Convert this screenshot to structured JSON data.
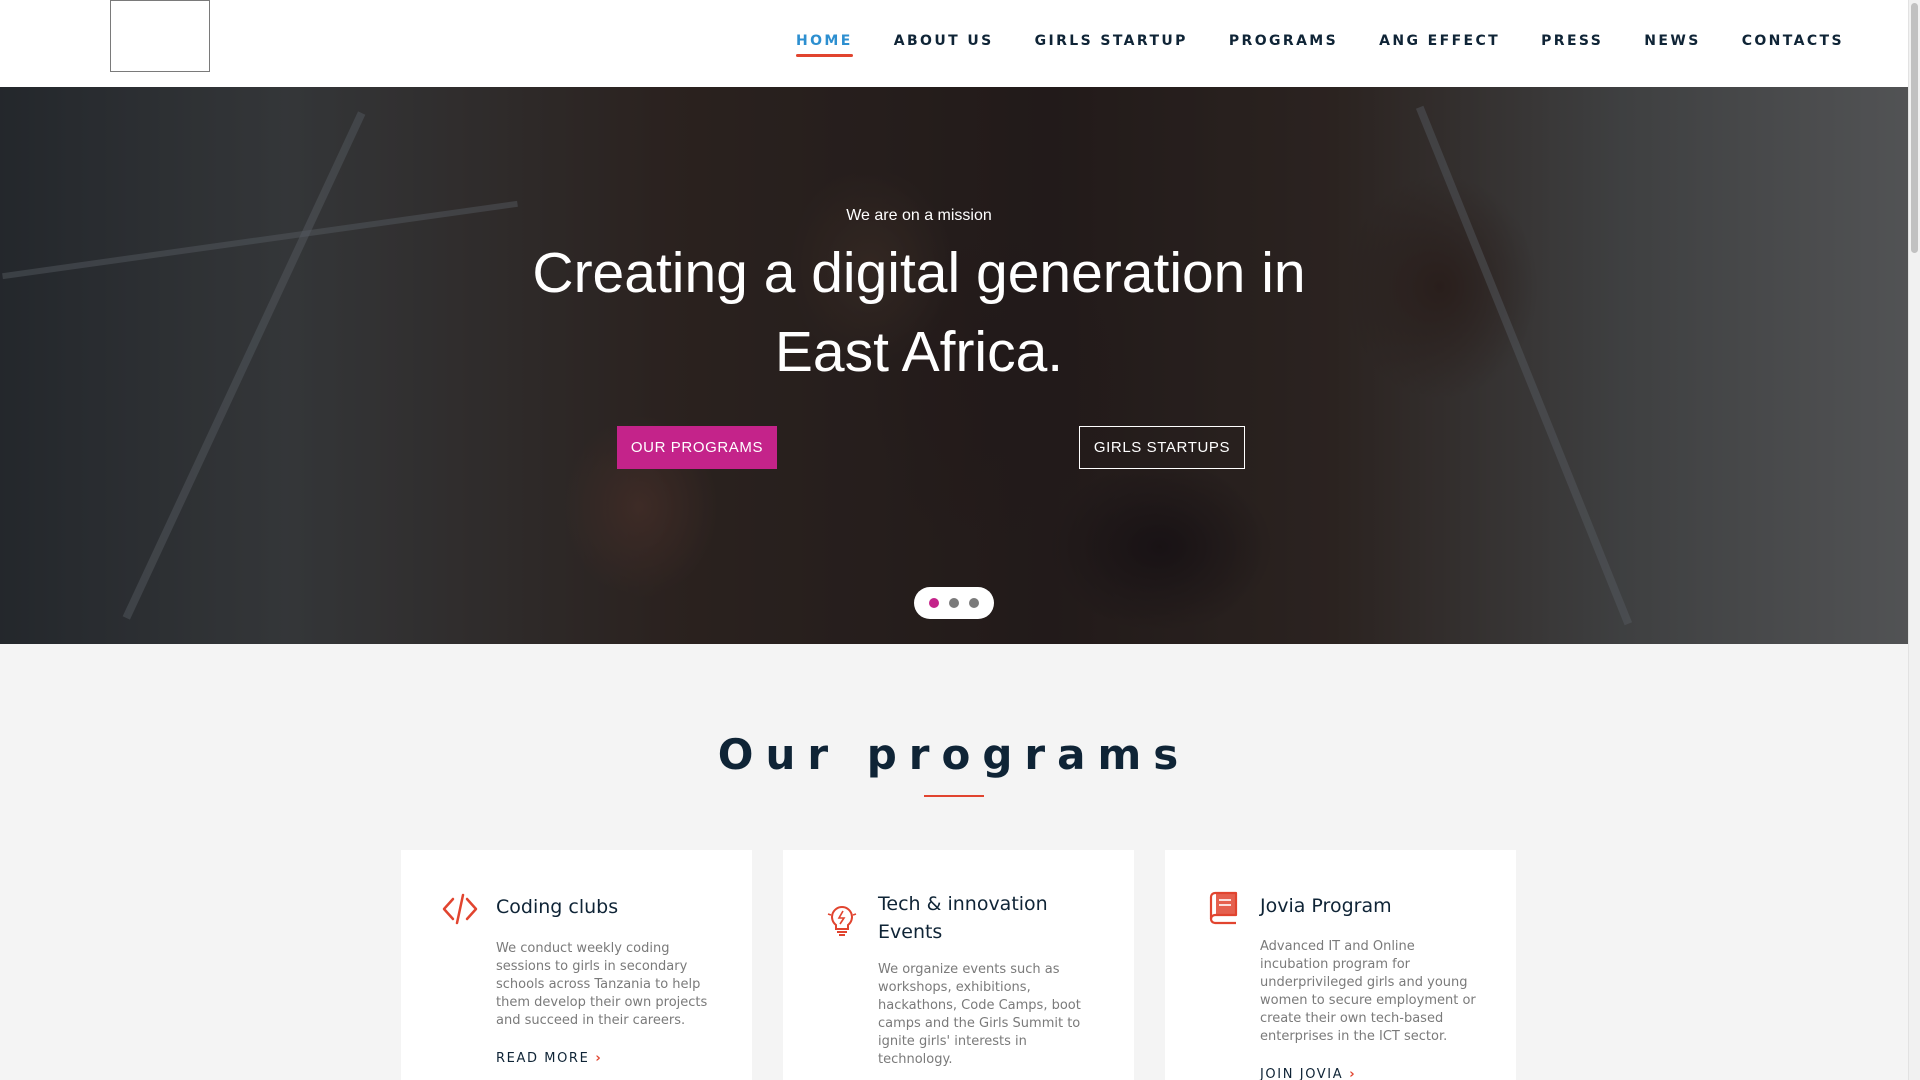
{
  "nav": {
    "items": [
      {
        "label": "HOME",
        "active": true
      },
      {
        "label": "ABOUT US",
        "active": false
      },
      {
        "label": "GIRLS STARTUP",
        "active": false
      },
      {
        "label": "PROGRAMS",
        "active": false
      },
      {
        "label": "ANG EFFECT",
        "active": false
      },
      {
        "label": "PRESS",
        "active": false
      },
      {
        "label": "NEWS",
        "active": false
      },
      {
        "label": "CONTACTS",
        "active": false
      }
    ]
  },
  "hero": {
    "eyebrow": "We are on a mission",
    "title_line1": "Creating a digital generation in",
    "title_line2": "East Africa.",
    "primary_button": "OUR PROGRAMS",
    "secondary_button": "GIRLS STARTUPS",
    "slide_count": 3,
    "active_slide": 1
  },
  "programs": {
    "title": "Our programs",
    "cards": [
      {
        "icon": "code-icon",
        "title": "Coding clubs",
        "description": "We conduct weekly coding sessions to  girls in secondary schools across Tanzania to help them develop their own projects and succeed in their careers.",
        "link": "READ MORE"
      },
      {
        "icon": "lightbulb-icon",
        "title": "Tech & innovation Events",
        "description": "We organize events such as workshops, exhibitions, hackathons, Code Camps, boot camps and the Girls Summit to ignite girls' interests in technology.",
        "link": ""
      },
      {
        "icon": "book-icon",
        "title": "Jovia Program",
        "description": "Advanced IT and Online incubation  program for underprivileged girls and young women to secure employment or create their own tech-based enterprises in the ICT sector.",
        "link": "JOIN JOVIA"
      }
    ]
  },
  "colors": {
    "accent": "#c4238a",
    "nav_active": "#2d8fd0",
    "underline": "#e1442f",
    "heading": "#0f2436"
  }
}
